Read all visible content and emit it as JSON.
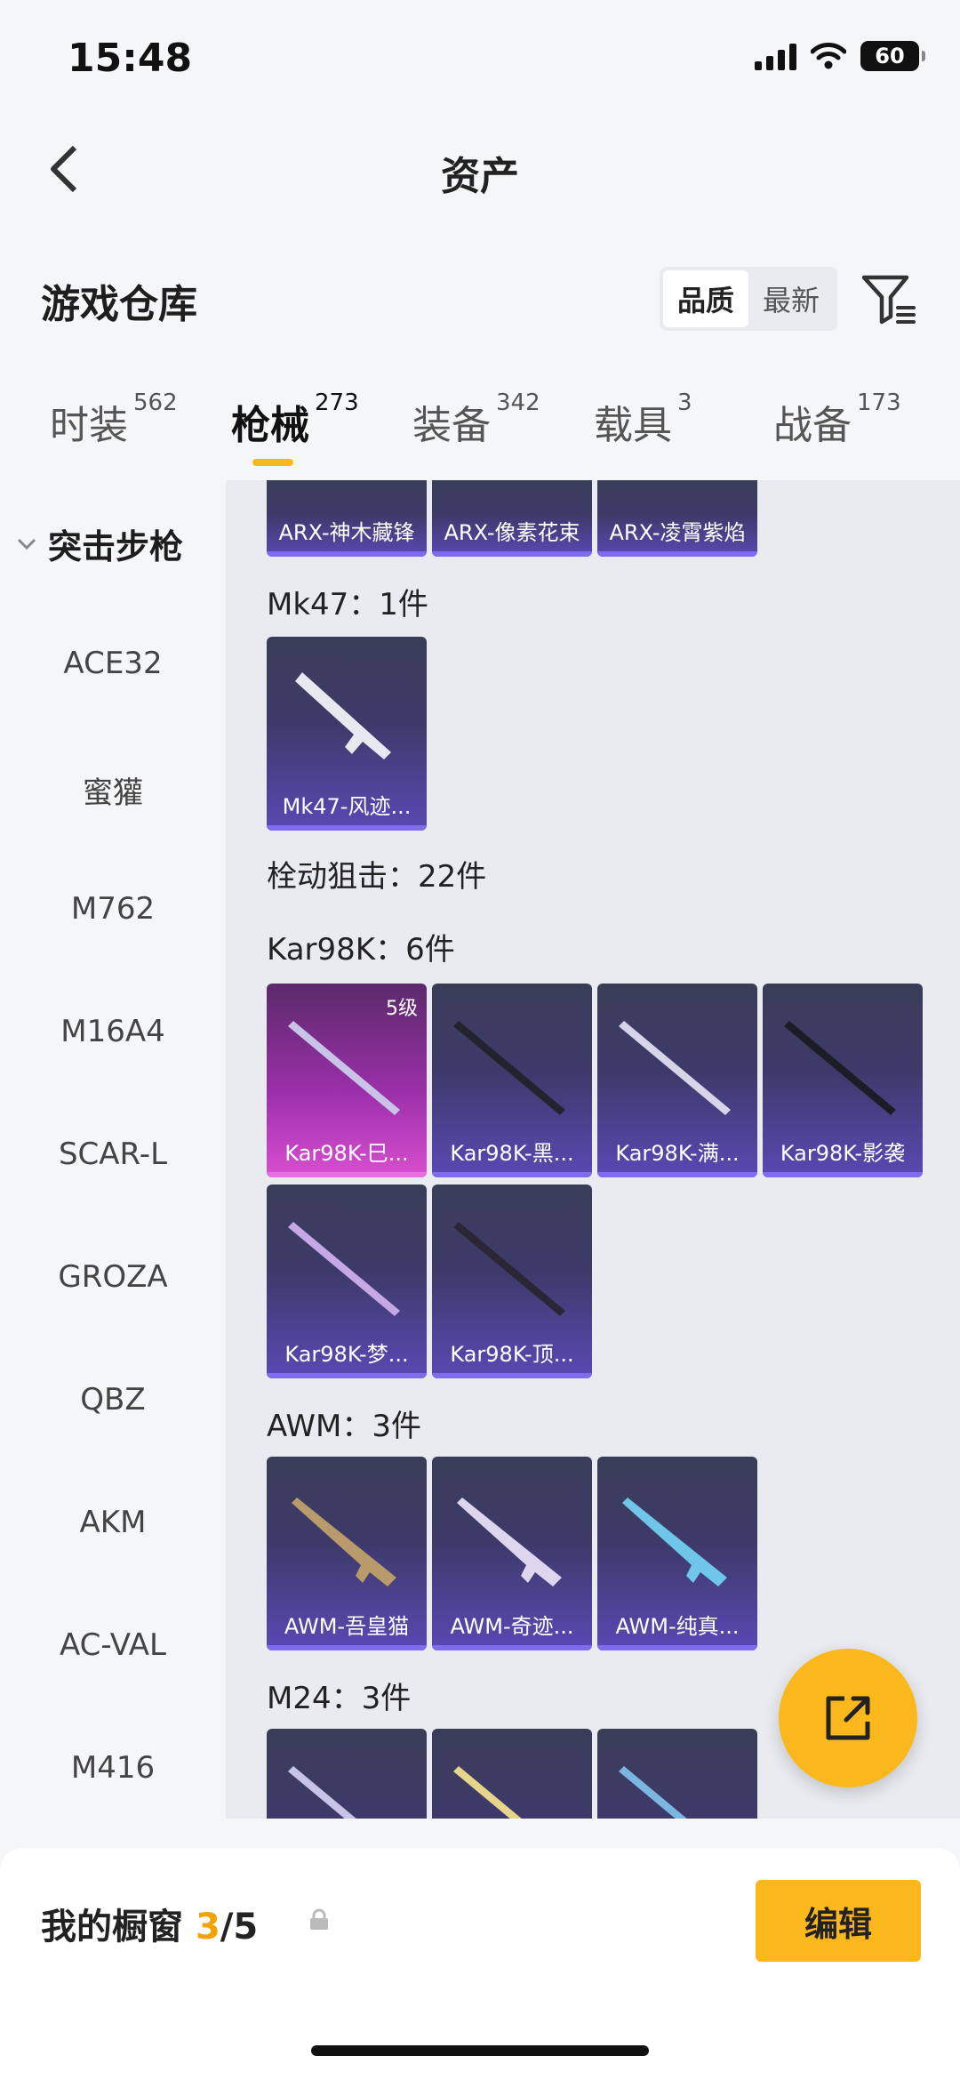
{
  "status": {
    "time": "15:48",
    "battery": "60"
  },
  "nav": {
    "title": "资产"
  },
  "section": {
    "title": "游戏仓库",
    "sort_options": [
      "品质",
      "最新"
    ]
  },
  "tabs": [
    {
      "label": "时装",
      "count": "562"
    },
    {
      "label": "枪械",
      "count": "273"
    },
    {
      "label": "装备",
      "count": "342"
    },
    {
      "label": "载具",
      "count": "3"
    },
    {
      "label": "战备",
      "count": "173"
    }
  ],
  "sidebar": {
    "category": "突击步枪",
    "items": [
      "ACE32",
      "蜜獾",
      "M762",
      "M16A4",
      "SCAR-L",
      "GROZA",
      "QBZ",
      "AKM",
      "AC-VAL",
      "M416"
    ]
  },
  "content": {
    "top_cards": [
      "ARX-神木藏锋",
      "ARX-像素花束",
      "ARX-凌霄紫焰"
    ],
    "mk47": {
      "label": "Mk47：1件",
      "cards": [
        "Mk47-风迹..."
      ]
    },
    "bolt_label": "栓动狙击：22件",
    "kar98k": {
      "label": "Kar98K：6件",
      "level_badge": "5级",
      "cards": [
        "Kar98K-巳...",
        "Kar98K-黑...",
        "Kar98K-满...",
        "Kar98K-影袭",
        "Kar98K-梦...",
        "Kar98K-顶..."
      ]
    },
    "awm": {
      "label": "AWM：3件",
      "cards": [
        "AWM-吾皇猫",
        "AWM-奇迹...",
        "AWM-纯真..."
      ]
    },
    "m24": {
      "label": "M24：3件"
    }
  },
  "bottom": {
    "title": "我的橱窗",
    "count_current": "3",
    "count_total": "/5",
    "edit_label": "编辑"
  },
  "colors": {
    "accent": "#fbb81c",
    "card_purple": "#5a48b4",
    "card_pink": "#d84fd0"
  },
  "icons": {
    "back": "chevron-left-icon",
    "filter": "filter-icon",
    "share": "share-export-icon",
    "lock": "lock-icon"
  }
}
